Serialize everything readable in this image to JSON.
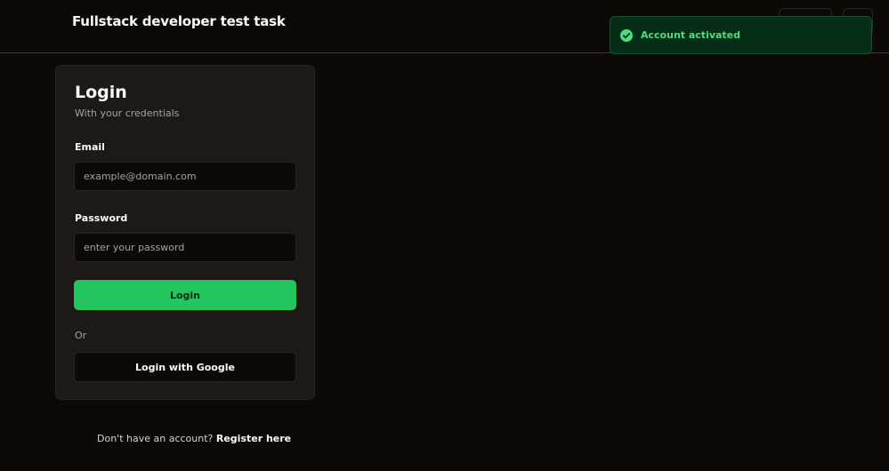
{
  "header": {
    "app_title": "Fullstack developer test task"
  },
  "toast": {
    "message": "Account activated",
    "icon": "check-circle-icon",
    "color": "#4ade80"
  },
  "login": {
    "title": "Login",
    "subtitle": "With your credentials",
    "email": {
      "label": "Email",
      "placeholder": "example@domain.com",
      "value": ""
    },
    "password": {
      "label": "Password",
      "placeholder": "enter your password",
      "value": ""
    },
    "submit_label": "Login",
    "divider_text": "Or",
    "google_label": "Login with Google"
  },
  "register": {
    "prompt": "Don't have an account?",
    "link_label": "Register here"
  },
  "colors": {
    "background": "#0c0a09",
    "card": "#1c1917",
    "accent": "#22c55e",
    "header_border": "#7f1d1d"
  }
}
